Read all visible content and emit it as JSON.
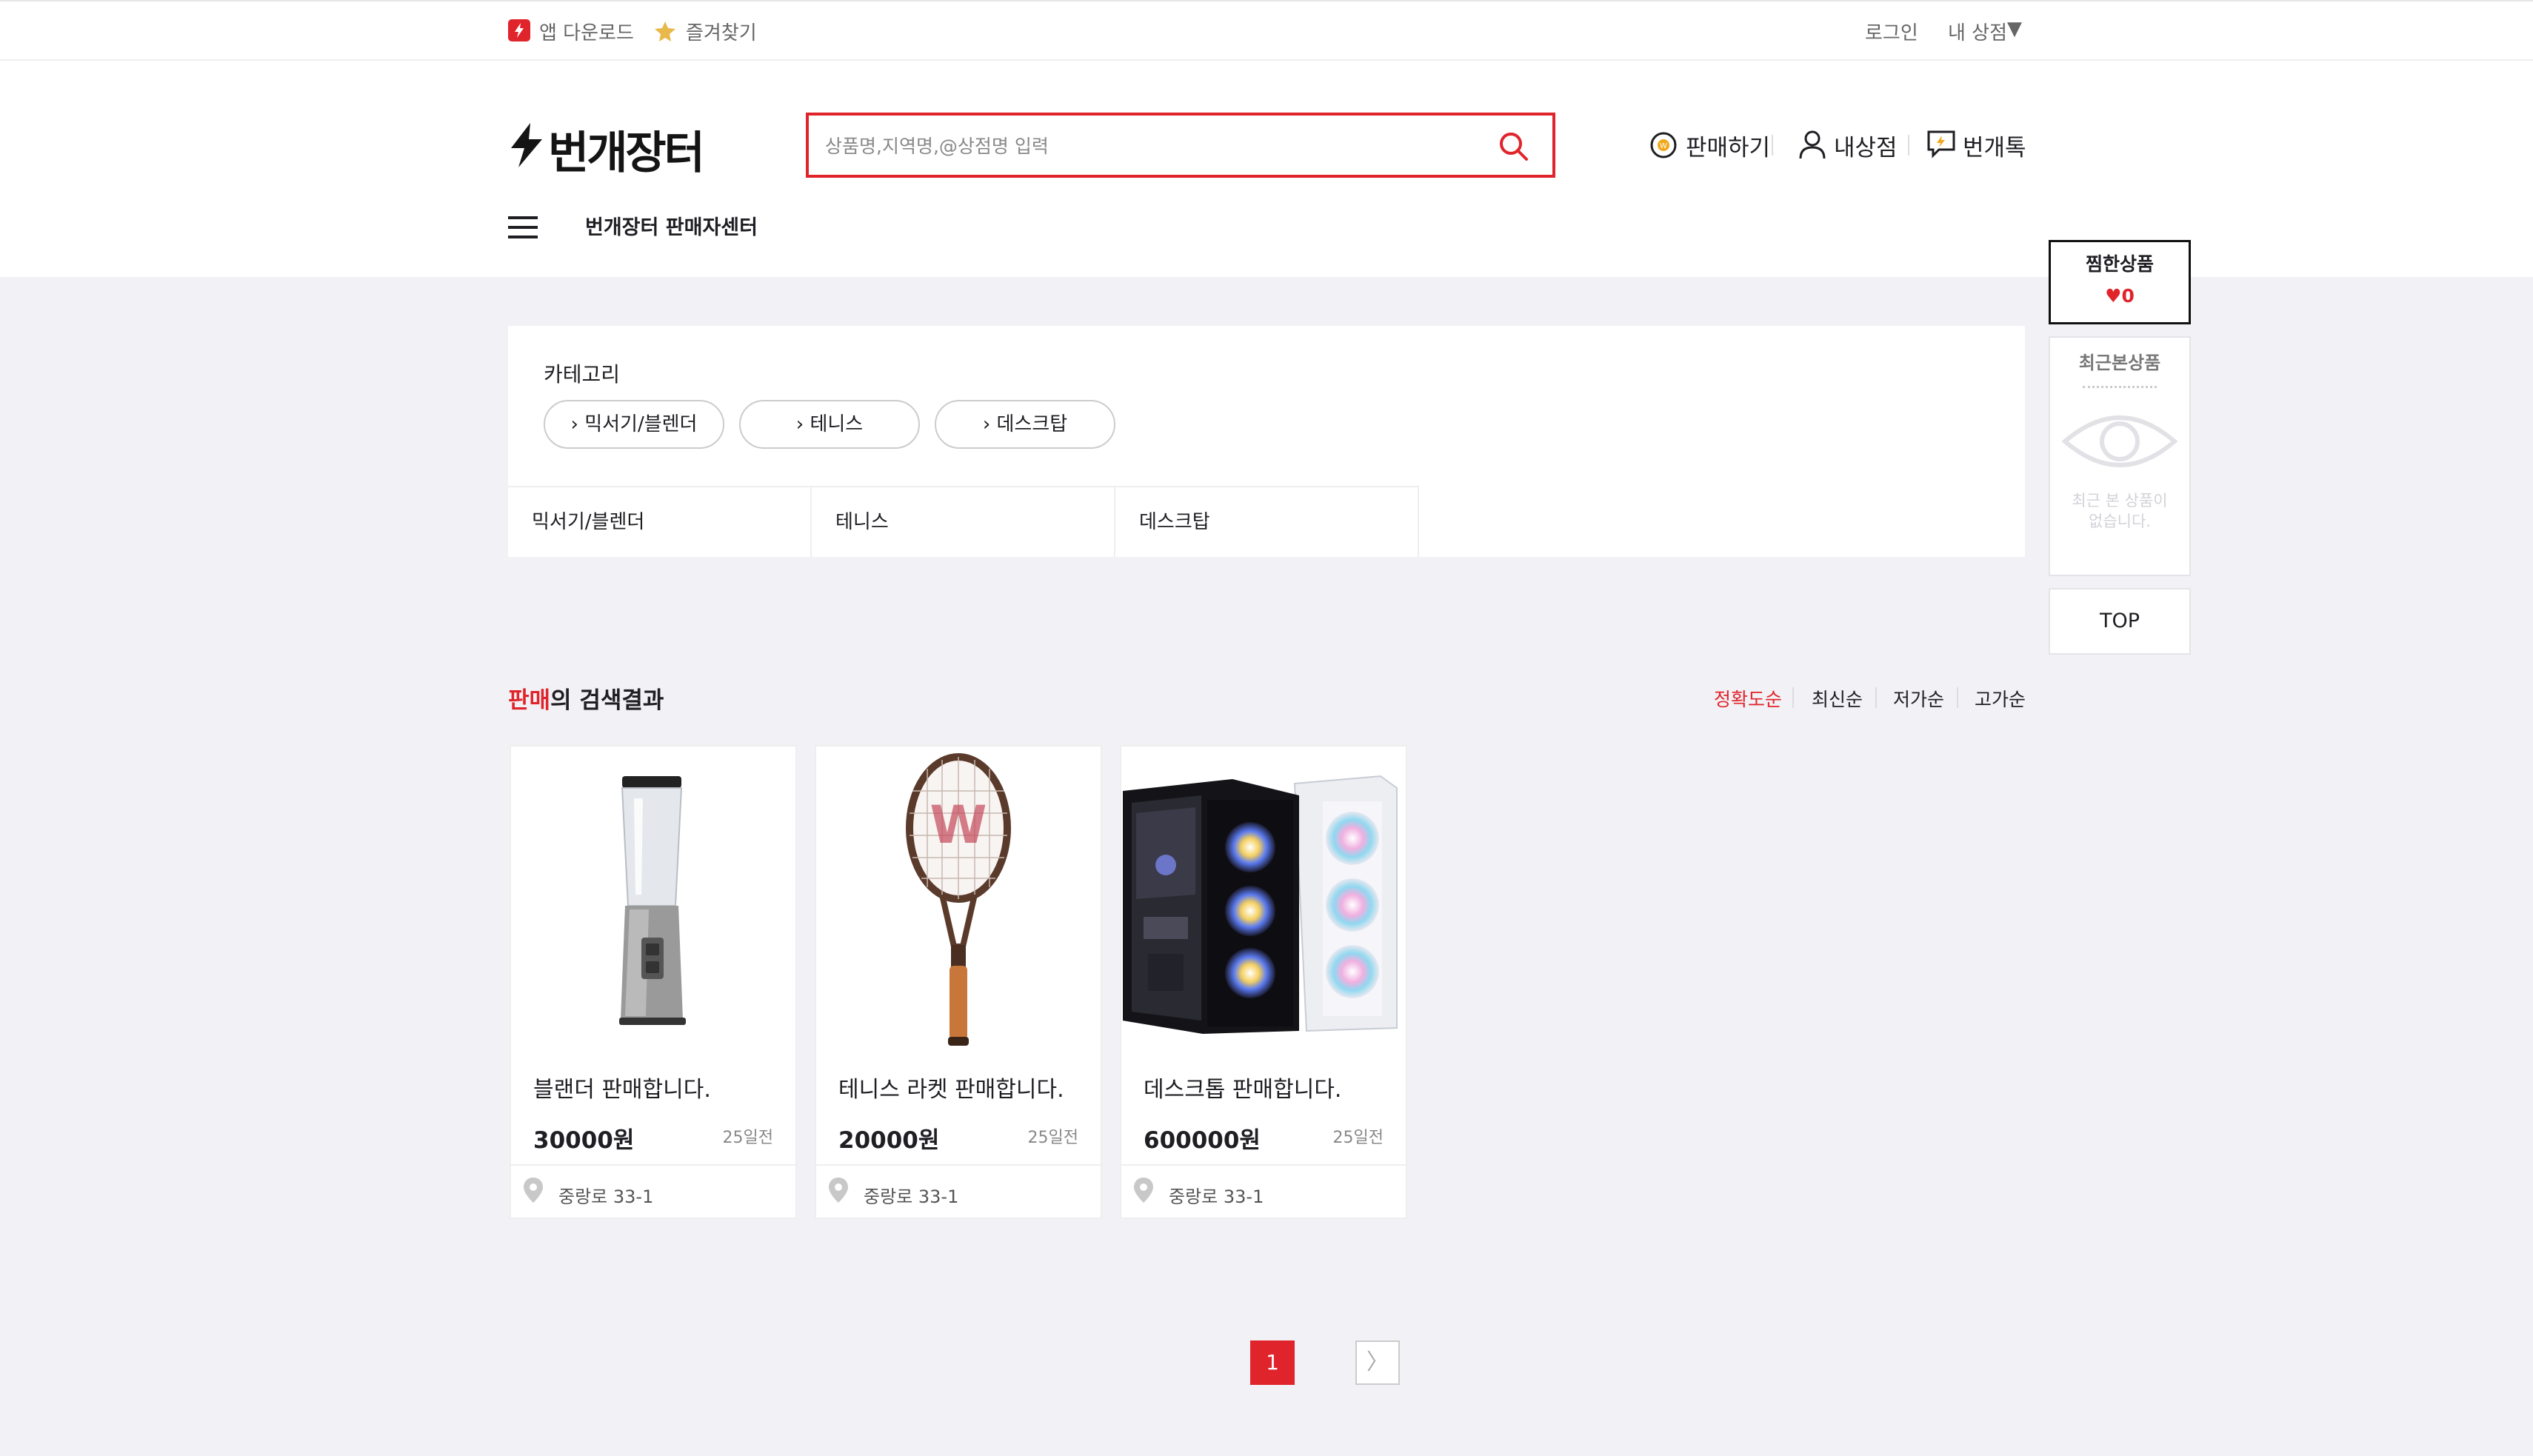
{
  "topbar": {
    "app_download": "앱 다운로드",
    "favorites": "즐겨찾기",
    "login": "로그인",
    "my_store": "내 상점",
    "my_store_caret": "▼"
  },
  "header": {
    "logo": "번개장터",
    "search_placeholder": "상품명,지역명,@상점명 입력",
    "sell": "판매하기",
    "my_shop": "내상점",
    "talk": "번개톡",
    "seller_center": "번개장터 판매자센터"
  },
  "category": {
    "label": "카테고리",
    "pills": [
      "믹서기/블렌더",
      "테니스",
      "데스크탑"
    ],
    "subcats": [
      "믹서기/블렌더",
      "테니스",
      "데스크탑"
    ]
  },
  "results": {
    "keyword": "판매",
    "suffix": "의 검색결과",
    "sort": [
      "정확도순",
      "최신순",
      "저가순",
      "고가순"
    ],
    "active_sort_color": "#e0242b"
  },
  "products": [
    {
      "name": "블랜더 판매합니다.",
      "price": "30000원",
      "ago": "25일전",
      "location": "중랑로 33-1",
      "image": "blender"
    },
    {
      "name": "테니스 라켓 판매합니다.",
      "price": "20000원",
      "ago": "25일전",
      "location": "중랑로 33-1",
      "image": "tennis-racket"
    },
    {
      "name": "데스크톱 판매합니다.",
      "price": "600000원",
      "ago": "25일전",
      "location": "중랑로 33-1",
      "image": "desktop-pc"
    }
  ],
  "side": {
    "wishlist_title": "찜한상품",
    "wishlist_count": "0",
    "recent_title": "최근본상품",
    "recent_empty": "최근 본 상품이 없습니다.",
    "top": "TOP"
  },
  "pagination": {
    "current": "1",
    "next": "〉"
  },
  "colors": {
    "brand_red": "#e0242b",
    "background": "#f2f2f6"
  }
}
